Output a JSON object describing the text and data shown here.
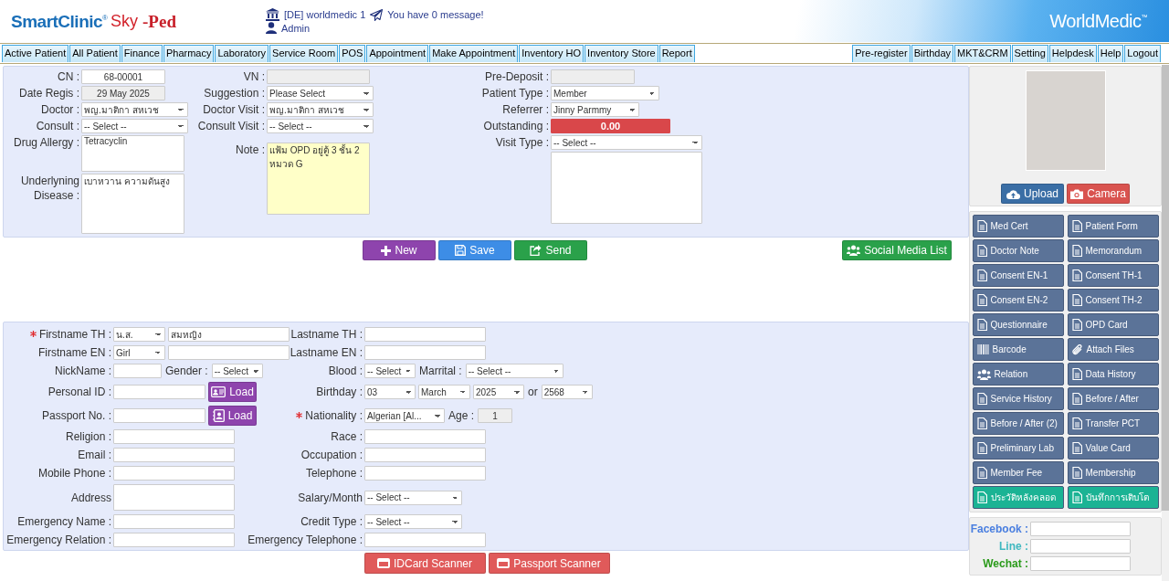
{
  "header": {
    "logo": {
      "brand": "SmartClinic",
      "registered": "®",
      "product": "Sky",
      "suffix": "-Ped"
    },
    "branch": "[DE] worldmedic 1",
    "message": "You have 0 message!",
    "user": "Admin",
    "company": "WorldMedic",
    "trademark": "™"
  },
  "nav": {
    "left": [
      {
        "label": "Active Patient"
      },
      {
        "label": "All Patient"
      },
      {
        "label": "Finance"
      },
      {
        "label": "Pharmacy"
      },
      {
        "label": "Laboratory"
      },
      {
        "label": "Service Room"
      },
      {
        "label": "POS"
      },
      {
        "label": "Appointment"
      },
      {
        "label": "Make Appointment"
      },
      {
        "label": "Inventory HO"
      },
      {
        "label": "Inventory Store"
      },
      {
        "label": "Report"
      }
    ],
    "right": [
      {
        "label": "Pre-register"
      },
      {
        "label": "Birthday"
      },
      {
        "label": "MKT&CRM"
      },
      {
        "label": "Setting"
      },
      {
        "label": "Helpdesk"
      },
      {
        "label": "Help"
      },
      {
        "label": "Logout"
      }
    ]
  },
  "visit_form": {
    "columns": [
      {
        "fields": [
          {
            "label": "CN :",
            "kind": "text",
            "value": "68-00001"
          },
          {
            "label": "Date Regis :",
            "kind": "readonly",
            "value": "29 May 2025"
          },
          {
            "label": "Doctor :",
            "kind": "select",
            "value": "พญ.มาติกา สหเวช"
          },
          {
            "label": "Consult :",
            "kind": "select",
            "value": "-- Select --"
          },
          {
            "label": "Drug Allergy :",
            "kind": "textarea",
            "value": "Tetracyclin"
          },
          {
            "label": "Underlyning Disease :",
            "kind": "textarea_tall",
            "value": "เบาหวาน ความดันสูง"
          }
        ]
      },
      {
        "fields": [
          {
            "label": "VN :",
            "kind": "readonly"
          },
          {
            "label": "Suggestion :",
            "kind": "select",
            "value": "Please Select"
          },
          {
            "label": "Doctor Visit :",
            "kind": "select",
            "value": "พญ.มาติกา สหเวช"
          },
          {
            "label": "Consult Visit :",
            "kind": "select",
            "value": "-- Select --"
          },
          {
            "label": "Note :",
            "kind": "note",
            "value": "แฟ้ม OPD อยู่ตู้ 3 ชั้น 2\nหมวด G"
          }
        ]
      },
      {
        "fields": [
          {
            "label": "Pre-Deposit :",
            "kind": "readonly"
          },
          {
            "label": "Patient Type :",
            "kind": "select",
            "value": "Member"
          },
          {
            "label": "Referrer :",
            "kind": "select_mid",
            "value": "Jinny Parmmy"
          },
          {
            "label": "Outstanding :",
            "kind": "alert",
            "value": "0.00"
          },
          {
            "label": "Visit Type :",
            "kind": "select_wide",
            "value": "-- Select --"
          },
          {
            "kind": "textarea_box"
          }
        ]
      }
    ]
  },
  "actions": [
    {
      "label": "New",
      "kind": "new"
    },
    {
      "label": "Save",
      "kind": "save"
    },
    {
      "label": "Send",
      "kind": "send"
    }
  ],
  "social_media_button": {
    "label": "Social Media List"
  },
  "patient_form": {
    "rows": [
      {
        "left": {
          "label": "Firstname TH :",
          "required": true,
          "items": [
            {
              "kind": "select_s",
              "value": "น.ส."
            },
            {
              "kind": "input",
              "value": "สมหญิง"
            }
          ]
        },
        "right": {
          "label": "Lastname TH :",
          "required": false,
          "items": [
            {
              "kind": "input"
            }
          ]
        }
      },
      {
        "left": {
          "label": "Firstname EN :",
          "required": false,
          "items": [
            {
              "kind": "select_s",
              "value": "Girl"
            },
            {
              "kind": "input"
            }
          ]
        },
        "right": {
          "label": "Lastname EN :",
          "required": false,
          "items": [
            {
              "kind": "input"
            }
          ]
        }
      },
      {
        "left": {
          "label": "NickName :",
          "required": false,
          "items": [
            {
              "kind": "input_s"
            },
            {
              "kind": "label",
              "text": "Gender :"
            },
            {
              "kind": "select_xs",
              "value": "-- Select"
            }
          ]
        },
        "right": {
          "label": "Blood :",
          "required": false,
          "items": [
            {
              "kind": "select_xs",
              "value": "-- Select"
            },
            {
              "kind": "label",
              "text": "Marrital :"
            },
            {
              "kind": "select_l",
              "value": "-- Select --"
            }
          ]
        }
      },
      {
        "left": {
          "label": "Personal ID :",
          "required": false,
          "items": [
            {
              "kind": "input_m"
            },
            {
              "kind": "id_load",
              "text": "Load"
            }
          ]
        },
        "right": {
          "label": "Birthday :",
          "required": false,
          "items": [
            {
              "kind": "select_xs",
              "value": "03"
            },
            {
              "kind": "select_s",
              "value": "March"
            },
            {
              "kind": "select_xs",
              "value": "2025"
            },
            {
              "kind": "label",
              "text": "or"
            },
            {
              "kind": "select_xs",
              "value": "2568"
            }
          ]
        }
      },
      {
        "left": {
          "label": "Passport No. :",
          "required": false,
          "items": [
            {
              "kind": "input_m"
            },
            {
              "kind": "passport_load",
              "text": "Load"
            }
          ]
        },
        "right": {
          "label": "Nationality :",
          "required": true,
          "items": [
            {
              "kind": "select_m",
              "value": "Algerian [Al..."
            },
            {
              "kind": "label",
              "text": "Age :"
            },
            {
              "kind": "readonly_s",
              "value": "1"
            }
          ]
        }
      },
      {
        "left": {
          "label": "Religion :",
          "required": false,
          "items": [
            {
              "kind": "input"
            }
          ]
        },
        "right": {
          "label": "Race :",
          "required": false,
          "items": [
            {
              "kind": "input"
            }
          ]
        }
      },
      {
        "left": {
          "label": "Email :",
          "required": false,
          "items": [
            {
              "kind": "input"
            }
          ]
        },
        "right": {
          "label": "Occupation :",
          "required": false,
          "items": [
            {
              "kind": "input"
            }
          ]
        }
      },
      {
        "left": {
          "label": "Mobile Phone :",
          "required": false,
          "items": [
            {
              "kind": "input"
            }
          ]
        },
        "right": {
          "label": "Telephone :",
          "required": false,
          "items": [
            {
              "kind": "input"
            }
          ]
        }
      },
      {
        "left": {
          "label": "Address",
          "required": false,
          "items": [
            {
              "kind": "textarea"
            }
          ]
        },
        "right": {
          "label": "Salary/Month",
          "required": false,
          "items": [
            {
              "kind": "select_l",
              "value": "-- Select --"
            }
          ]
        }
      },
      {
        "left": {
          "label": "Emergency Name :",
          "required": false,
          "items": [
            {
              "kind": "input"
            }
          ]
        },
        "right": {
          "label": "Credit Type :",
          "required": false,
          "items": [
            {
              "kind": "select_l",
              "value": "-- Select --"
            }
          ]
        }
      },
      {
        "left": {
          "label": "Emergency Relation :",
          "required": false,
          "items": [
            {
              "kind": "input"
            }
          ]
        },
        "right": {
          "label": "Emergency Telephone :",
          "required": false,
          "items": [
            {
              "kind": "input"
            }
          ]
        }
      }
    ]
  },
  "scanners": [
    {
      "label": "IDCard Scanner"
    },
    {
      "label": "Passport Scanner"
    }
  ],
  "sidebar": {
    "photo_buttons": [
      {
        "label": "Upload",
        "kind": "upload"
      },
      {
        "label": "Camera",
        "kind": "camera"
      }
    ],
    "documents": [
      {
        "label": "Med Cert",
        "kind": "form",
        "color": "#5b7398"
      },
      {
        "label": "Patient Form",
        "kind": "form",
        "color": "#5b7398"
      },
      {
        "label": "Doctor Note",
        "kind": "form",
        "color": "#5b7398"
      },
      {
        "label": "Memorandum",
        "kind": "form",
        "color": "#5b7398"
      },
      {
        "label": "Consent EN-1",
        "kind": "form",
        "color": "#5b7398"
      },
      {
        "label": "Consent TH-1",
        "kind": "form",
        "color": "#5b7398"
      },
      {
        "label": "Consent EN-2",
        "kind": "form",
        "color": "#5b7398"
      },
      {
        "label": "Consent TH-2",
        "kind": "form",
        "color": "#5b7398"
      },
      {
        "label": "Questionnaire",
        "kind": "form",
        "color": "#5b7398"
      },
      {
        "label": "OPD Card",
        "kind": "form",
        "color": "#5b7398"
      },
      {
        "label": "Barcode",
        "kind": "barcode",
        "color": "#5b7398"
      },
      {
        "label": "Attach Files",
        "kind": "attachment",
        "color": "#5b7398"
      },
      {
        "label": "Relation",
        "kind": "relation",
        "color": "#5b7398"
      },
      {
        "label": "Data History",
        "kind": "form",
        "color": "#5b7398"
      },
      {
        "label": "Service History",
        "kind": "form",
        "color": "#5b7398"
      },
      {
        "label": "Before / After",
        "kind": "form",
        "color": "#5b7398"
      },
      {
        "label": "Before / After (2)",
        "kind": "form",
        "color": "#5b7398"
      },
      {
        "label": "Transfer PCT",
        "kind": "form",
        "color": "#5b7398"
      },
      {
        "label": "Preliminary Lab",
        "kind": "form",
        "color": "#5b7398"
      },
      {
        "label": "Value Card",
        "kind": "form",
        "color": "#5b7398"
      },
      {
        "label": "Member Fee",
        "kind": "form",
        "color": "#5b7398"
      },
      {
        "label": "Membership",
        "kind": "form",
        "color": "#5b7398"
      },
      {
        "label": "ประวัติหลังคลอด",
        "kind": "form",
        "color": "#1bb394"
      },
      {
        "label": "บันทึกการเติบโต",
        "kind": "form",
        "color": "#1bb394"
      }
    ],
    "social": [
      {
        "label": "Facebook :",
        "color": "#4a7fe0"
      },
      {
        "label": "Line :",
        "color": "#3fb8c0"
      },
      {
        "label": "Wechat :",
        "color": "#2a9a1a"
      }
    ]
  }
}
